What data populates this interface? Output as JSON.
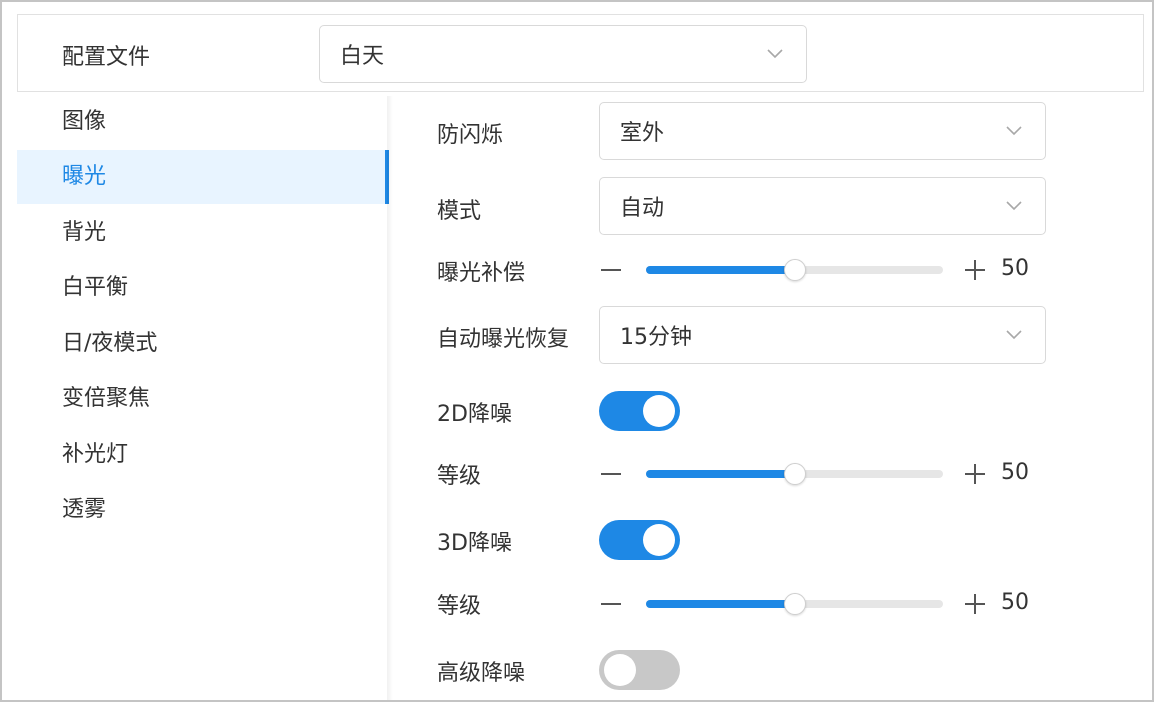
{
  "profile": {
    "label": "配置文件",
    "value": "白天"
  },
  "sidebar": {
    "items": [
      {
        "label": "图像",
        "active": false
      },
      {
        "label": "曝光",
        "active": true
      },
      {
        "label": "背光",
        "active": false
      },
      {
        "label": "白平衡",
        "active": false
      },
      {
        "label": "日/夜模式",
        "active": false
      },
      {
        "label": "变倍聚焦",
        "active": false
      },
      {
        "label": "补光灯",
        "active": false
      },
      {
        "label": "透雾",
        "active": false
      }
    ]
  },
  "settings": {
    "anti_flicker": {
      "label": "防闪烁",
      "value": "室外"
    },
    "mode": {
      "label": "模式",
      "value": "自动"
    },
    "exposure_comp": {
      "label": "曝光补偿",
      "value": "50",
      "fraction": 0.5
    },
    "auto_exposure_recovery": {
      "label": "自动曝光恢复",
      "value": "15分钟"
    },
    "nr_2d": {
      "label": "2D降噪",
      "enabled": true
    },
    "nr_2d_level": {
      "label": "等级",
      "value": "50",
      "fraction": 0.5
    },
    "nr_3d": {
      "label": "3D降噪",
      "enabled": true
    },
    "nr_3d_level": {
      "label": "等级",
      "value": "50",
      "fraction": 0.5
    },
    "advanced_nr": {
      "label": "高级降噪",
      "enabled": false
    }
  },
  "colors": {
    "accent": "#1e88e5",
    "active_bg": "#e8f4ff",
    "toggle_off": "#c8c8c8"
  },
  "icons": {
    "dropdown": "chevron-down-icon",
    "decrease": "minus-icon",
    "increase": "plus-icon"
  }
}
